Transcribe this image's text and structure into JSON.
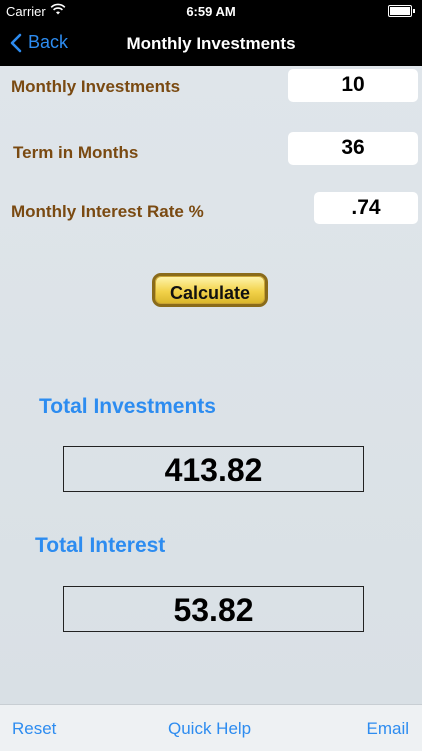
{
  "status": {
    "carrier": "Carrier",
    "time": "6:59 AM"
  },
  "nav": {
    "back_label": "Back",
    "title": "Monthly Investments"
  },
  "form": {
    "monthly_investments": {
      "label": "Monthly Investments",
      "value": "10"
    },
    "term_in_months": {
      "label": "Term in Months",
      "value": "36"
    },
    "interest_rate": {
      "label": "Monthly Interest Rate %",
      "value": ".74"
    },
    "calculate_label": "Calculate"
  },
  "results": {
    "total_investments": {
      "label": "Total Investments",
      "value": "413.82"
    },
    "total_interest": {
      "label": "Total Interest",
      "value": "53.82"
    }
  },
  "toolbar": {
    "reset": "Reset",
    "quick_help": "Quick Help",
    "email": "Email"
  },
  "colors": {
    "accent": "#2d8cf0",
    "label_brown": "#7a4a12",
    "button_gold": "#f2d24a",
    "background": "#dde3e8"
  }
}
